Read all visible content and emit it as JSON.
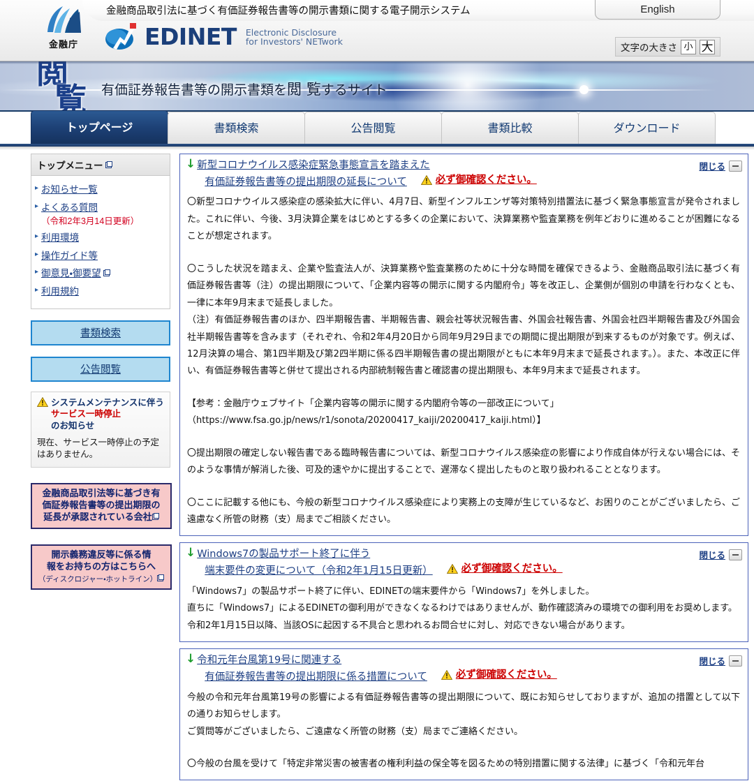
{
  "header": {
    "system_title": "金融商品取引法に基づく有価証券報告書等の開示書類に関する電子開示システム",
    "english_tab": "English",
    "fsa_logo_text": "金融庁",
    "edinet_word": "EDINET",
    "edinet_tagline_line1": "Electronic Disclosure",
    "edinet_tagline_line2": "for Investors' NETwork",
    "fontsize_label": "文字の大きさ",
    "fontsize_small": "小",
    "fontsize_large": "大"
  },
  "banner": {
    "kanji_line1": "閲",
    "kanji_line2": "覧",
    "subtitle_pre": "有価証券報告書等の開示書類を",
    "subtitle_em": "閲 覧",
    "subtitle_post": "するサイト"
  },
  "nav": {
    "tabs": [
      {
        "label": "トップページ",
        "active": true
      },
      {
        "label": "書類検索",
        "active": false
      },
      {
        "label": "公告閲覧",
        "active": false
      },
      {
        "label": "書類比較",
        "active": false
      },
      {
        "label": "ダウンロード",
        "active": false
      }
    ]
  },
  "sidebar": {
    "menu_title": "トップメニュー",
    "menu_items": [
      {
        "label": "お知らせ一覧",
        "note": "",
        "external": false
      },
      {
        "label": "よくある質問",
        "note": "（令和2年3月14日更新）",
        "external": false
      },
      {
        "label": "利用環境",
        "note": "",
        "external": false
      },
      {
        "label": "操作ガイド等",
        "note": "",
        "external": false
      },
      {
        "label": "御意見・御要望",
        "note": "",
        "external": true
      },
      {
        "label": "利用規約",
        "note": "",
        "external": false
      }
    ],
    "buttons": [
      {
        "label": "書類検索"
      },
      {
        "label": "公告閲覧"
      }
    ],
    "maintenance": {
      "title_line1": "システムメンテナンスに伴う",
      "title_line2": "サービス一時停止",
      "title_line3": "のお知らせ",
      "body": "現在、サービス一時停止の予定はありません。"
    },
    "pink_buttons": [
      {
        "line1": "金融商品取引法等に基づき有",
        "line2": "価証券報告書等の提出期限の",
        "line3": "延長が承認されている会社",
        "sub": "",
        "external": true
      },
      {
        "line1": "開示義務違反等に係る情",
        "line2": "報をお持ちの方はこちらへ",
        "line3": "",
        "sub": "（ディスクロジャー・ホットライン）",
        "external": true
      }
    ]
  },
  "panels": [
    {
      "title_line1": "新型コロナウイルス感染症緊急事態宣言を踏まえた",
      "title_line2": "有価証券報告書等の提出期限の延長について",
      "warning": "必ず御確認ください。",
      "close_label": "閉じる",
      "paragraphs": [
        "〇新型コロナウイルス感染症の感染拡大に伴い、4月7日、新型インフルエンザ等対策特別措置法に基づく緊急事態宣言が発令されました。これに伴い、今後、3月決算企業をはじめとする多くの企業において、決算業務や監査業務を例年どおりに進めることが困難になることが想定されます。",
        "",
        "〇こうした状況を踏まえ、企業や監査法人が、決算業務や監査業務のために十分な時間を確保できるよう、金融商品取引法に基づく有価証券報告書等（注）の提出期限について、「企業内容等の開示に関する内閣府令」等を改正し、企業側が個別の申請を行わなくとも、一律に本年9月末まで延長しました。",
        "（注）有価証券報告書のほか、四半期報告書、半期報告書、親会社等状況報告書、外国会社報告書、外国会社四半期報告書及び外国会社半期報告書等を含みます（それぞれ、令和2年4月20日から同年9月29日までの期間に提出期限が到来するものが対象です。例えば、12月決算の場合、第1四半期及び第2四半期に係る四半期報告書の提出期限がともに本年9月末まで延長されます。）。また、本改正に伴い、有価証券報告書等と併せて提出される内部統制報告書と確認書の提出期限も、本年9月末まで延長されます。",
        "",
        "【参考：金融庁ウェブサイト「企業内容等の開示に関する内閣府令等の一部改正について」",
        "（https://www.fsa.go.jp/news/r1/sonota/20200417_kaiji/20200417_kaiji.html）】",
        "",
        "〇提出期限の確定しない報告書である臨時報告書については、新型コロナウイルス感染症の影響により作成自体が行えない場合には、そのような事情が解消した後、可及的速やかに提出することで、遅滞なく提出したものと取り扱われることとなります。",
        "",
        "〇ここに記載する他にも、今般の新型コロナウイルス感染症により実務上の支障が生じているなど、お困りのことがございましたら、ご遠慮なく所管の財務（支）局までご相談ください。"
      ]
    },
    {
      "title_line1": "Windows7の製品サポート終了に伴う",
      "title_line2": "端末要件の変更について（令和2年1月15日更新）",
      "warning": "必ず御確認ください。",
      "close_label": "閉じる",
      "paragraphs": [
        "「Windows7」の製品サポート終了に伴い、EDINETの端末要件から「Windows7」を外しました。",
        "直ちに「Windows7」によるEDINETの御利用ができなくなるわけではありませんが、動作確認済みの環境での御利用をお奨めします。",
        "令和2年1月15日以降、当該OSに起因する不具合と思われるお問合せに対し、対応できない場合があります。"
      ]
    },
    {
      "title_line1": "令和元年台風第19号に関連する",
      "title_line2": "有価証券報告書等の提出期限に係る措置について",
      "warning": "必ず御確認ください。",
      "close_label": "閉じる",
      "paragraphs": [
        "今般の令和元年台風第19号の影響による有価証券報告書等の提出期限について、既にお知らせしておりますが、追加の措置として以下の通りお知らせします。",
        "ご質問等がございましたら、ご遠慮なく所管の財務（支）局までご連絡ください。",
        "",
        "〇今般の台風を受けて「特定非常災害の被害者の権利利益の保全等を図るための特別措置に関する法律」に基づく「令和元年台"
      ]
    }
  ],
  "colors": {
    "accent_blue": "#1d3f84",
    "warning_red": "#cc0000",
    "panel_border": "#4b62b9",
    "tab_active_bg": "#1d4176",
    "pink_box": "#f7c9c9",
    "side_button": "#b4dcf0"
  }
}
